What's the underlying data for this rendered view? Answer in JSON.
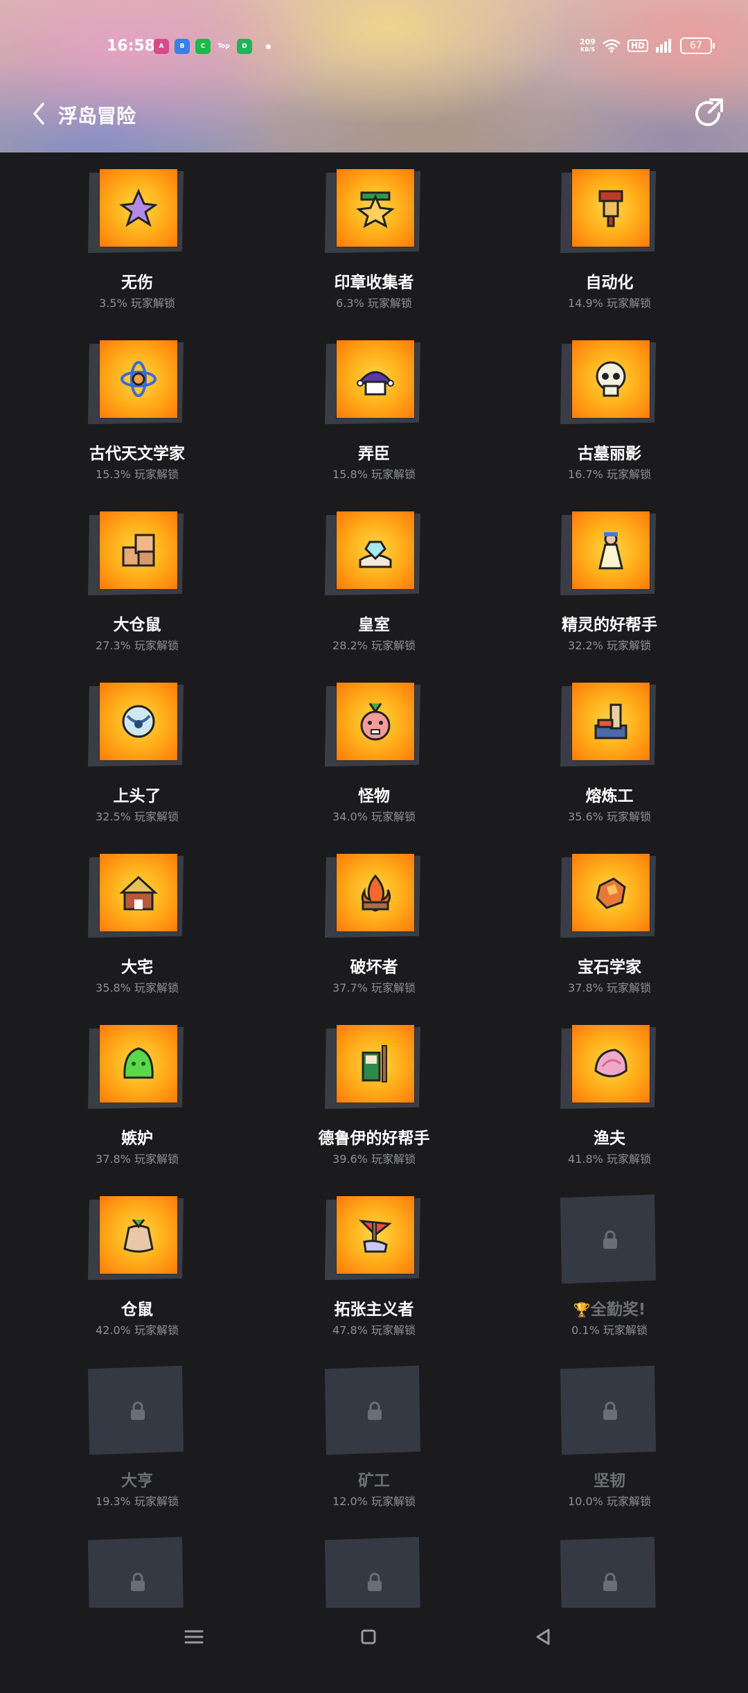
{
  "status": {
    "time": "16:58",
    "net_speed_value": "209",
    "net_speed_unit": "KB/S",
    "hd_label": "HD",
    "battery": "67",
    "app_icons": [
      {
        "name": "app-icon-1",
        "color": "#d64b8a",
        "label": "A"
      },
      {
        "name": "app-icon-2",
        "color": "#3a7ee8",
        "label": "B"
      },
      {
        "name": "app-icon-3",
        "color": "#1fb84a",
        "label": "C"
      },
      {
        "name": "top-app-icon",
        "color": "transparent",
        "label": "Top"
      },
      {
        "name": "app-icon-5",
        "color": "#22b35a",
        "label": "D"
      }
    ]
  },
  "header": {
    "title": "浮岛冒险"
  },
  "achievements": [
    {
      "name": "无伤",
      "pct": "3.5% 玩家解锁",
      "locked": false,
      "icon": "star-figure"
    },
    {
      "name": "印章收集者",
      "pct": "6.3% 玩家解锁",
      "locked": false,
      "icon": "star"
    },
    {
      "name": "自动化",
      "pct": "14.9% 玩家解锁",
      "locked": false,
      "icon": "machine"
    },
    {
      "name": "古代天文学家",
      "pct": "15.3% 玩家解锁",
      "locked": false,
      "icon": "atom"
    },
    {
      "name": "弄臣",
      "pct": "15.8% 玩家解锁",
      "locked": false,
      "icon": "jester-hat"
    },
    {
      "name": "古墓丽影",
      "pct": "16.7% 玩家解锁",
      "locked": false,
      "icon": "skull"
    },
    {
      "name": "大仓鼠",
      "pct": "27.3% 玩家解锁",
      "locked": false,
      "icon": "boxes"
    },
    {
      "name": "皇室",
      "pct": "28.2% 玩家解锁",
      "locked": false,
      "icon": "gem-hand"
    },
    {
      "name": "精灵的好帮手",
      "pct": "32.2% 玩家解锁",
      "locked": false,
      "icon": "fairy"
    },
    {
      "name": "上头了",
      "pct": "32.5% 玩家解锁",
      "locked": false,
      "icon": "orb"
    },
    {
      "name": "怪物",
      "pct": "34.0% 玩家解锁",
      "locked": false,
      "icon": "radish-monster"
    },
    {
      "name": "熔炼工",
      "pct": "35.6% 玩家解锁",
      "locked": false,
      "icon": "forge"
    },
    {
      "name": "大宅",
      "pct": "35.8% 玩家解锁",
      "locked": false,
      "icon": "house"
    },
    {
      "name": "破坏者",
      "pct": "37.7% 玩家解锁",
      "locked": false,
      "icon": "fire"
    },
    {
      "name": "宝石学家",
      "pct": "37.8% 玩家解锁",
      "locked": false,
      "icon": "ore"
    },
    {
      "name": "嫉妒",
      "pct": "37.8% 玩家解锁",
      "locked": false,
      "icon": "slime"
    },
    {
      "name": "德鲁伊的好帮手",
      "pct": "39.6% 玩家解锁",
      "locked": false,
      "icon": "druid"
    },
    {
      "name": "渔夫",
      "pct": "41.8% 玩家解锁",
      "locked": false,
      "icon": "shell"
    },
    {
      "name": "仓鼠",
      "pct": "42.0% 玩家解锁",
      "locked": false,
      "icon": "sack"
    },
    {
      "name": "拓张主义者",
      "pct": "47.8% 玩家解锁",
      "locked": false,
      "icon": "flag"
    },
    {
      "name": "全勤奖!",
      "pct": "0.1% 玩家解锁",
      "locked": true,
      "trophy": true
    },
    {
      "name": "大亨",
      "pct": "19.3% 玩家解锁",
      "locked": true
    },
    {
      "name": "矿工",
      "pct": "12.0% 玩家解锁",
      "locked": true
    },
    {
      "name": "坚韧",
      "pct": "10.0% 玩家解锁",
      "locked": true
    },
    {
      "name": "",
      "pct": "",
      "locked": true
    },
    {
      "name": "",
      "pct": "",
      "locked": true
    },
    {
      "name": "",
      "pct": "",
      "locked": true
    }
  ],
  "colors": {
    "background": "#1b1b1d",
    "tile_orange": "#ff9a12",
    "locked_tile": "#353944"
  }
}
